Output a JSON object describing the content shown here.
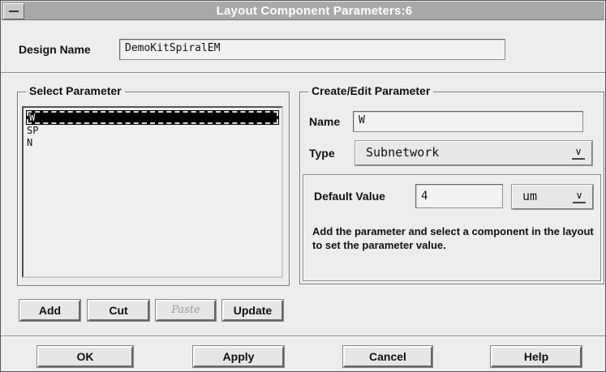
{
  "window": {
    "title": "Layout Component Parameters:6"
  },
  "design": {
    "label": "Design Name",
    "value": "DemoKitSpiralEM"
  },
  "select_parameter": {
    "title": "Select Parameter",
    "items": [
      "W",
      "SP",
      "N"
    ],
    "selected_index": 0
  },
  "edit_parameter": {
    "title": "Create/Edit Parameter",
    "name_label": "Name",
    "name_value": "W",
    "type_label": "Type",
    "type_value": "Subnetwork",
    "default_label": "Default Value",
    "default_value": "4",
    "unit_value": "um",
    "help_text": "Add the parameter and select a component in the layout to set the parameter value."
  },
  "list_buttons": {
    "add": "Add",
    "cut": "Cut",
    "paste": "Paste",
    "update": "Update"
  },
  "dialog_buttons": {
    "ok": "OK",
    "apply": "Apply",
    "cancel": "Cancel",
    "help": "Help"
  },
  "colors": {
    "titlebar": "#a9a9a9",
    "background": "#ededed",
    "selection": "#000000"
  }
}
